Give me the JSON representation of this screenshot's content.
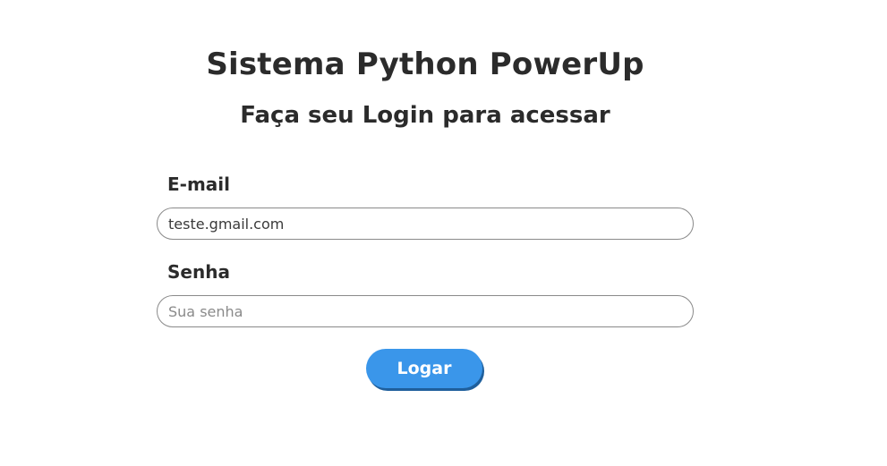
{
  "header": {
    "title": "Sistema Python PowerUp",
    "subtitle": "Faça seu Login para acessar"
  },
  "form": {
    "email_label": "E-mail",
    "email_value": "teste.gmail.com",
    "password_label": "Senha",
    "password_placeholder": "Sua senha",
    "submit_label": "Logar"
  },
  "colors": {
    "button": "#3a96ea",
    "button_shadow": "#1f5f9c",
    "text": "#2b2b2b",
    "field_border": "#8a8a8a"
  }
}
